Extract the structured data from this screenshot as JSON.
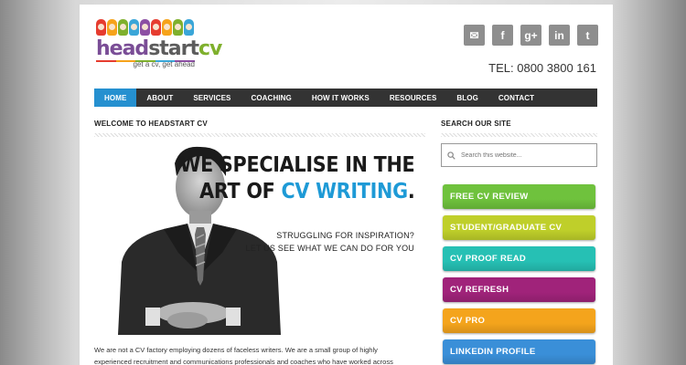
{
  "logo": {
    "head": "head",
    "start": "start",
    "cv": "cv",
    "tagline": "get a cv, get ahead",
    "face_colors": [
      "#e63c2f",
      "#f6a31b",
      "#7fb02d",
      "#3aa6d8",
      "#8c4fa3",
      "#e63c2f",
      "#f6a31b",
      "#7fb02d",
      "#3aa6d8"
    ],
    "bar_colors": [
      "#e63c2f",
      "#f6a31b",
      "#7fb02d",
      "#3aa6d8",
      "#8c4fa3"
    ]
  },
  "social": [
    {
      "name": "email-icon",
      "glyph": "✉"
    },
    {
      "name": "facebook-icon",
      "glyph": "f"
    },
    {
      "name": "google-plus-icon",
      "glyph": "g+"
    },
    {
      "name": "linkedin-icon",
      "glyph": "in"
    },
    {
      "name": "twitter-icon",
      "glyph": "t"
    }
  ],
  "tel": "TEL: 0800 3800 161",
  "nav": [
    "HOME",
    "ABOUT",
    "SERVICES",
    "COACHING",
    "HOW IT WORKS",
    "RESOURCES",
    "BLOG",
    "CONTACT"
  ],
  "main": {
    "welcome": "WELCOME TO HEADSTART CV",
    "headline_line1": "WE SPECIALISE IN THE",
    "headline_line2a": "ART OF ",
    "headline_line2b": "CV WRITING",
    "headline_line2c": ".",
    "sub_line1": "STRUGGLING FOR INSPIRATION?",
    "sub_line2": "LET US SEE WHAT WE CAN DO FOR YOU",
    "paragraph_line1": "We are not a CV factory employing dozens of faceless writers. We are a small group of highly",
    "paragraph_line2": "experienced recruitment and communications professionals and coaches who have worked across"
  },
  "sidebar": {
    "search_title": "SEARCH OUR SITE",
    "search_placeholder": "Search this website...",
    "buttons": [
      {
        "label": "FREE CV REVIEW",
        "color": "#6fc23d"
      },
      {
        "label": "STUDENT/GRADUATE CV",
        "color": "#bfcf2a"
      },
      {
        "label": "CV PROOF READ",
        "color": "#26c0b4"
      },
      {
        "label": "CV REFRESH",
        "color": "#a0237a"
      },
      {
        "label": "CV PRO",
        "color": "#f4a41c"
      },
      {
        "label": "LINKEDIN PROFILE",
        "color": "#3a8fd8"
      }
    ]
  },
  "colors": {
    "nav_bg": "#333333",
    "nav_active": "#2590d0",
    "accent_blue": "#1e9ad6"
  }
}
